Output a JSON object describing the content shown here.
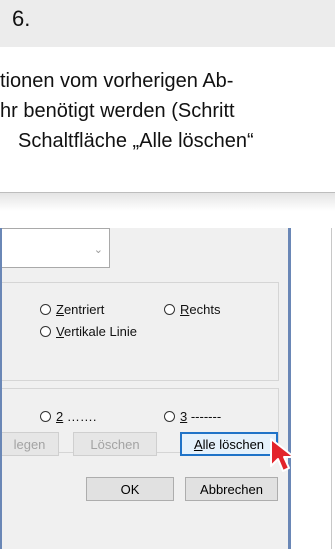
{
  "step": {
    "number": "6."
  },
  "instruction": {
    "line1": "tionen vom vorherigen Ab-",
    "line2": "hr benötigt werden (Schritt",
    "line3": "Schaltfläche „Alle löschen“"
  },
  "dialog": {
    "combo_arrow": "⌄",
    "alignment": {
      "centered": {
        "accel": "Z",
        "rest": "entriert"
      },
      "right": {
        "accel": "R",
        "rest": "echts"
      },
      "vertical_line": {
        "accel": "V",
        "rest": "ertikale Linie"
      }
    },
    "fill": {
      "opt2": {
        "accel": "2",
        "rest": " ……."
      },
      "opt3": {
        "accel": "3",
        "rest": " -------"
      }
    },
    "buttons": {
      "set_partial": "legen",
      "delete": "Löschen",
      "clear_all_accel": "A",
      "clear_all_rest": "lle löschen",
      "ok": "OK",
      "cancel": "Abbrechen"
    }
  }
}
